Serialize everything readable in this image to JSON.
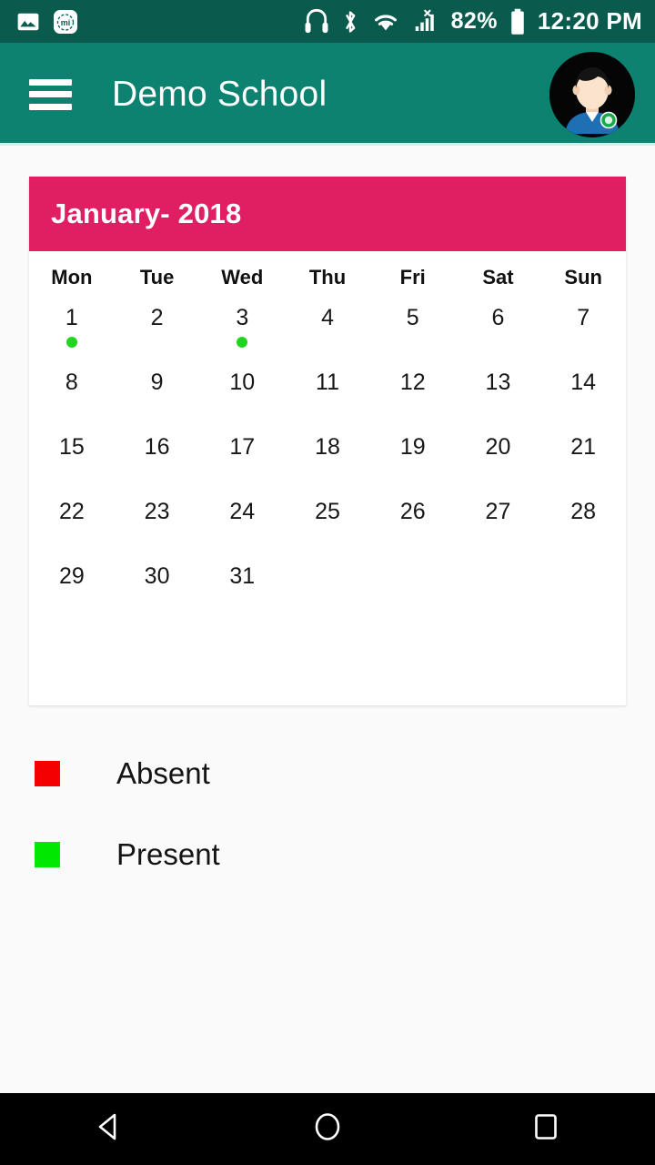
{
  "status_bar": {
    "background": "#0a5a4d",
    "left_icons": [
      {
        "name": "gallery-image-icon",
        "label": "image"
      },
      {
        "name": "mi-app-icon",
        "label": "mi"
      }
    ],
    "right_icons": [
      {
        "name": "headphones-icon",
        "label": "headphones"
      },
      {
        "name": "bluetooth-icon",
        "label": "bluetooth"
      },
      {
        "name": "wifi-icon",
        "label": "wifi"
      },
      {
        "name": "cellular-signal-no-sim-icon",
        "label": "signal-x"
      }
    ],
    "battery_percent": "82%",
    "time": "12:20 PM"
  },
  "app_bar": {
    "background": "#0d8270",
    "menu_icon": "hamburger-menu-icon",
    "title": "Demo School",
    "avatar_icon": "user-avatar"
  },
  "calendar": {
    "header_background": "#e01f63",
    "month_label": "January- 2018",
    "weekdays": [
      "Mon",
      "Tue",
      "Wed",
      "Thu",
      "Fri",
      "Sat",
      "Sun"
    ],
    "weeks": [
      [
        {
          "day": "1",
          "status": "present"
        },
        {
          "day": "2",
          "status": null
        },
        {
          "day": "3",
          "status": "present"
        },
        {
          "day": "4",
          "status": null
        },
        {
          "day": "5",
          "status": null
        },
        {
          "day": "6",
          "status": null
        },
        {
          "day": "7",
          "status": null
        }
      ],
      [
        {
          "day": "8",
          "status": null
        },
        {
          "day": "9",
          "status": null
        },
        {
          "day": "10",
          "status": null
        },
        {
          "day": "11",
          "status": null
        },
        {
          "day": "12",
          "status": null
        },
        {
          "day": "13",
          "status": null
        },
        {
          "day": "14",
          "status": null
        }
      ],
      [
        {
          "day": "15",
          "status": null
        },
        {
          "day": "16",
          "status": null
        },
        {
          "day": "17",
          "status": null
        },
        {
          "day": "18",
          "status": null
        },
        {
          "day": "19",
          "status": null
        },
        {
          "day": "20",
          "status": null
        },
        {
          "day": "21",
          "status": null
        }
      ],
      [
        {
          "day": "22",
          "status": null
        },
        {
          "day": "23",
          "status": null
        },
        {
          "day": "24",
          "status": null
        },
        {
          "day": "25",
          "status": null
        },
        {
          "day": "26",
          "status": null
        },
        {
          "day": "27",
          "status": null
        },
        {
          "day": "28",
          "status": null
        }
      ],
      [
        {
          "day": "29",
          "status": null
        },
        {
          "day": "30",
          "status": null
        },
        {
          "day": "31",
          "status": null
        },
        {
          "day": "",
          "status": null
        },
        {
          "day": "",
          "status": null
        },
        {
          "day": "",
          "status": null
        },
        {
          "day": "",
          "status": null
        }
      ]
    ],
    "status_colors": {
      "present": "#1fd51f",
      "absent": "#f40000"
    }
  },
  "legend": [
    {
      "label": "Absent",
      "color": "#f40000",
      "name": "legend-absent"
    },
    {
      "label": "Present",
      "color": "#00e800",
      "name": "legend-present"
    }
  ],
  "nav_bar": {
    "background": "#000000",
    "buttons": [
      {
        "name": "back-button",
        "icon": "back-triangle-icon"
      },
      {
        "name": "home-button",
        "icon": "home-circle-icon"
      },
      {
        "name": "recents-button",
        "icon": "recents-square-icon"
      }
    ]
  }
}
